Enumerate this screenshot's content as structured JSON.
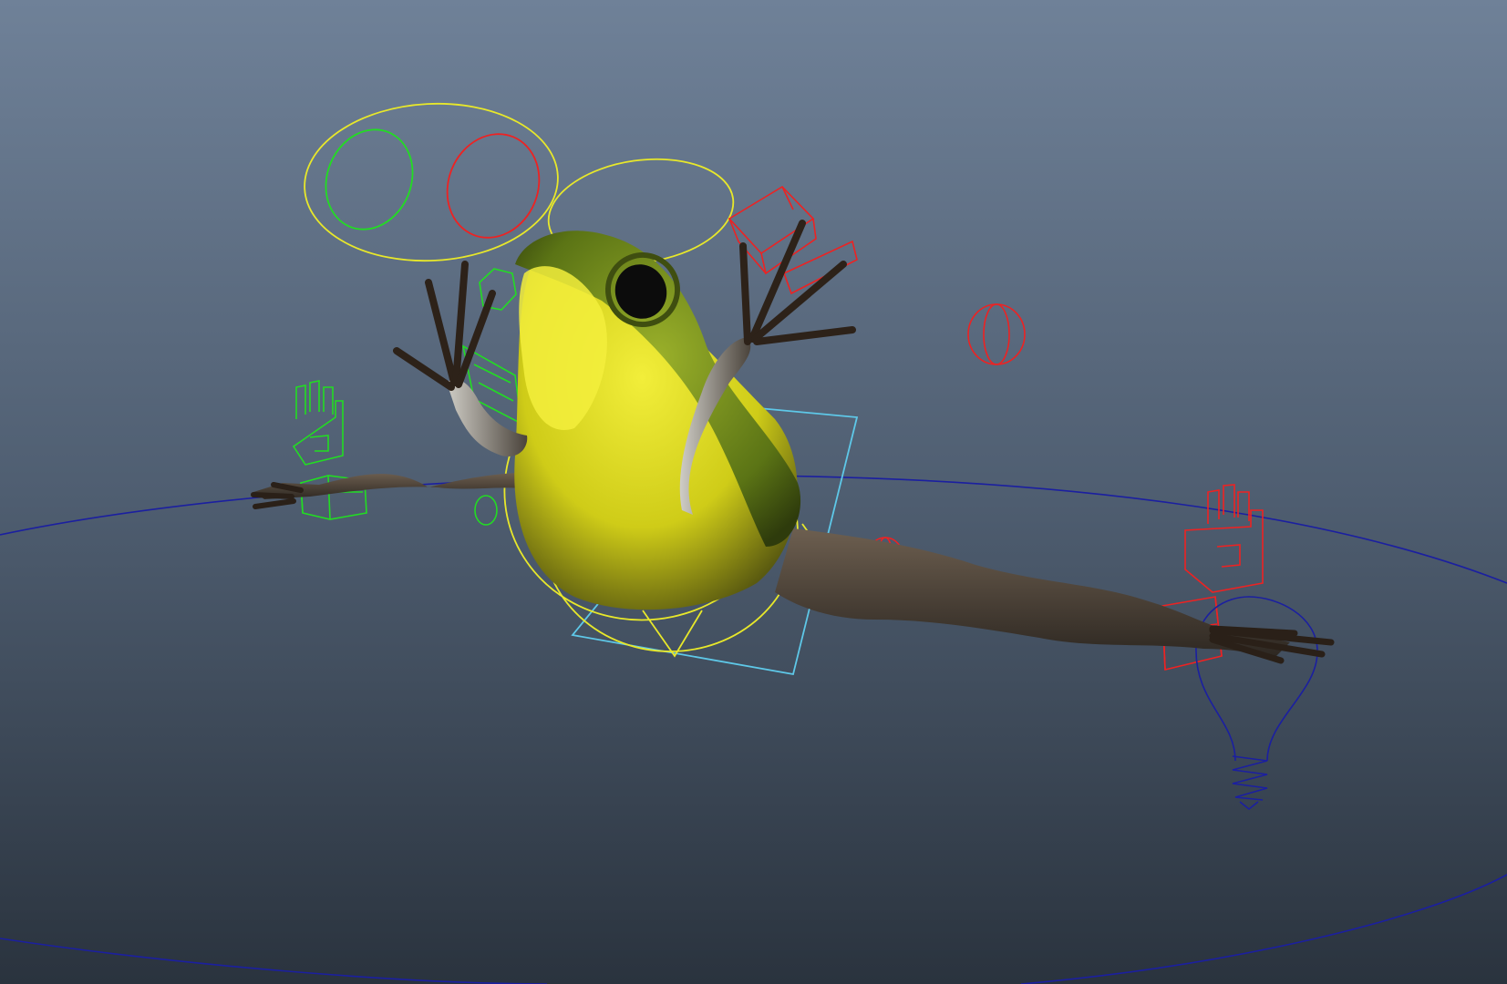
{
  "viewport": {
    "background_top": "#6f8198",
    "background_bottom": "#2a333e",
    "subject": "frog-character-model",
    "controls": [
      "eye-look-control",
      "head-control",
      "left-hand-ik-control",
      "right-hand-ik-control",
      "left-foot-ik-control",
      "right-foot-ik-control",
      "pole-vector-control",
      "torso-control",
      "hip-control",
      "light-bulb-icon",
      "world-circle-control"
    ],
    "colors": {
      "left_side": "#22dd22",
      "right_side": "#ee2222",
      "center": "#e8e82a",
      "hip": "#5ec8e8",
      "world": "#1b1fa0",
      "frog_belly": "#d6d31c",
      "frog_back": "#6e8a1a",
      "frog_limb": "#4a3f35"
    }
  }
}
